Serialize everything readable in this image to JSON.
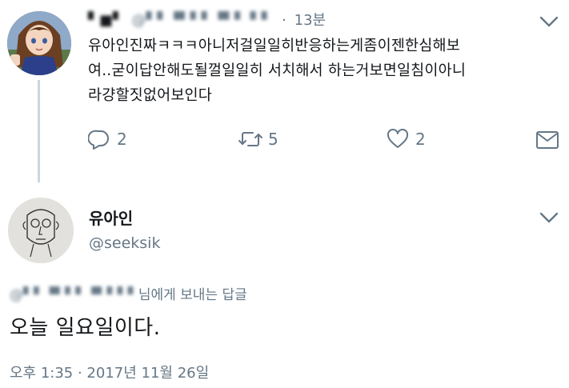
{
  "parent_tweet": {
    "display_name": "▘■▘",
    "handle": "@▘▘▝▘▘▘▝▘▘ ▘▘",
    "separator": "·",
    "time": "13분",
    "text_lines": [
      "유아인진짜ㅋㅋㅋ아니저걸일일히반응하는게좀이젠한심해보",
      "여..굳이답안해도될껄일일히 서치해서 하는거보면일침이아니",
      "라걍할짓없어보인다"
    ],
    "reply_count": "2",
    "retweet_count": "5",
    "like_count": "2",
    "icons": {
      "reply": "reply-icon",
      "retweet": "retweet-icon",
      "like": "heart-icon",
      "dm": "envelope-icon",
      "menu": "chevron-down-icon"
    }
  },
  "main_tweet": {
    "display_name": "유아인",
    "handle": "@seeksik",
    "replying_to_handle": "@▘▘▝▘▘▘▝▘▘▘▘",
    "replying_to_suffix": "님에게 보내는 답글",
    "text": "오늘 일요일이다.",
    "timestamp": "오후 1:35 · 2017년 11월 26일",
    "icons": {
      "menu": "chevron-down-icon"
    }
  },
  "colors": {
    "thread_line": "#ccd6dd",
    "muted_text": "#657786",
    "primary_text": "#14171a"
  }
}
